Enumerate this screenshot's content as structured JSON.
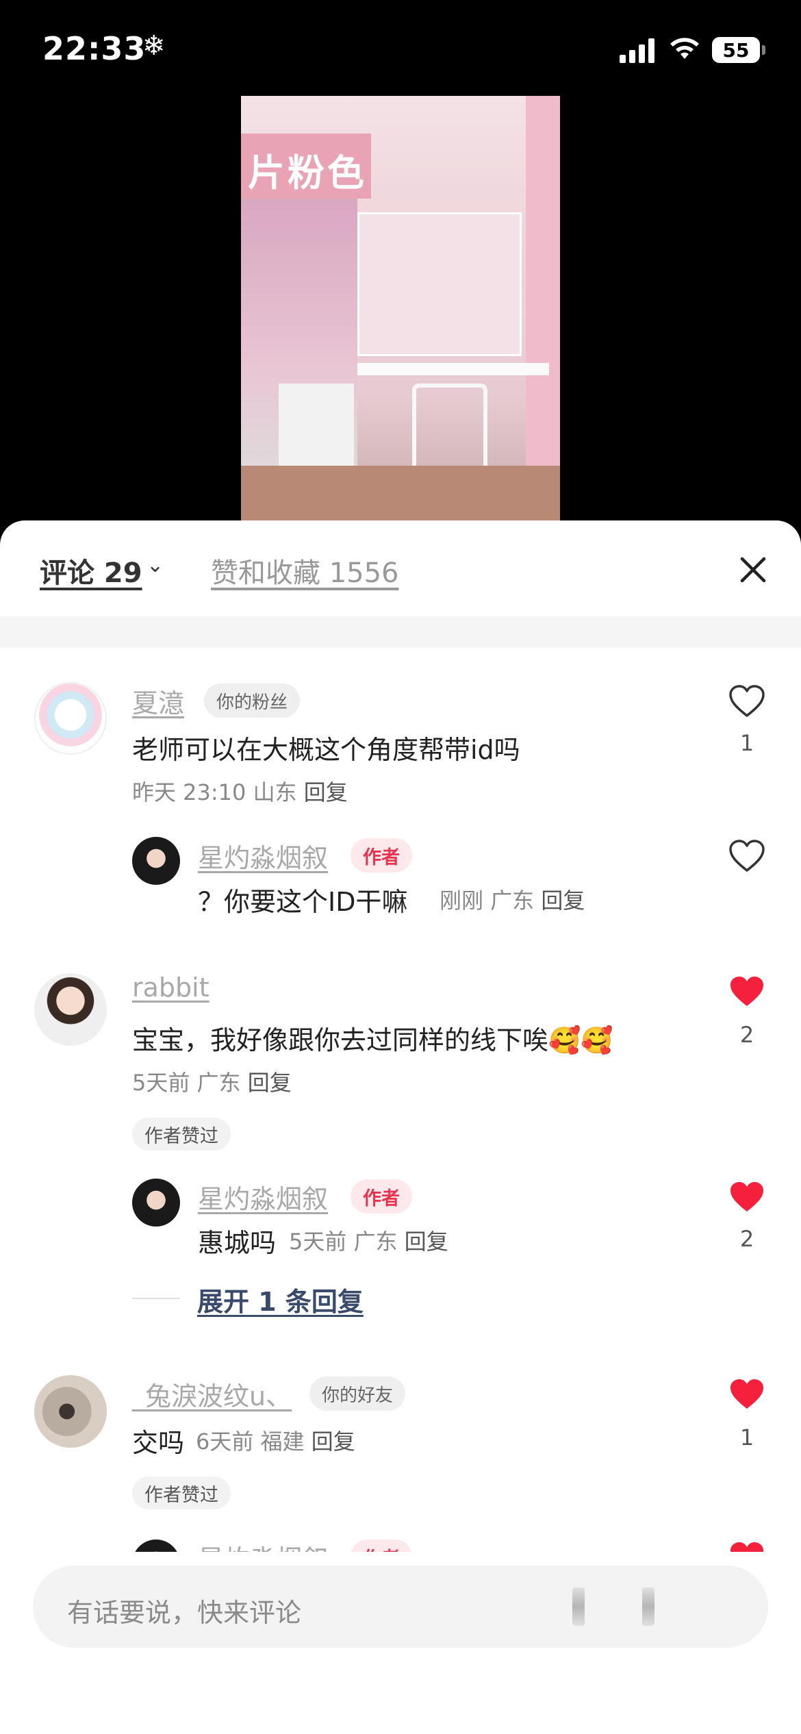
{
  "status_bar": {
    "time": "22:33",
    "battery": "55"
  },
  "tabs": {
    "comments": "评论 29",
    "likes": "赞和收藏 1556"
  },
  "video": {
    "banner_text": "片粉色"
  },
  "comments": [
    {
      "name": "夏澺",
      "badge": "你的粉丝",
      "text": "老师可以在大概这个角度帮带id吗",
      "meta": "昨天 23:10 山东",
      "reply_label": "回复",
      "likes": "1",
      "liked": false,
      "reply": {
        "name": "星灼淼烟叙",
        "badge": "作者",
        "text": "？你要这个ID干嘛",
        "meta": "刚刚 广东",
        "reply_label": "回复",
        "liked": false
      }
    },
    {
      "name": "rabbit",
      "text": "宝宝，我好像跟你去过同样的线下唉🥰🥰",
      "meta": "5天前 广东",
      "reply_label": "回复",
      "likes": "2",
      "liked": true,
      "author_liked": "作者赞过",
      "reply": {
        "name": "星灼淼烟叙",
        "badge": "作者",
        "text": "惠城吗",
        "meta": "5天前 广东",
        "reply_label": "回复",
        "likes": "2",
        "liked": true
      },
      "expand": "展开 1 条回复"
    },
    {
      "name": "_兔淚波纹u、",
      "badge": "你的好友",
      "text": "交吗",
      "meta": "6天前 福建",
      "reply_label": "回复",
      "likes": "1",
      "liked": true,
      "author_liked": "作者赞过",
      "reply": {
        "name": "星灼淼烟叙",
        "badge": "作者"
      }
    }
  ],
  "input": {
    "placeholder": "有话要说，快来评论"
  },
  "colors": {
    "heart_red": "#f5213c",
    "author_red": "#e8334f"
  },
  "icons": [
    "snowflake-icon",
    "signal-icon",
    "wifi-icon",
    "battery-icon",
    "chevron-down-icon",
    "close-icon",
    "heart-icon"
  ]
}
